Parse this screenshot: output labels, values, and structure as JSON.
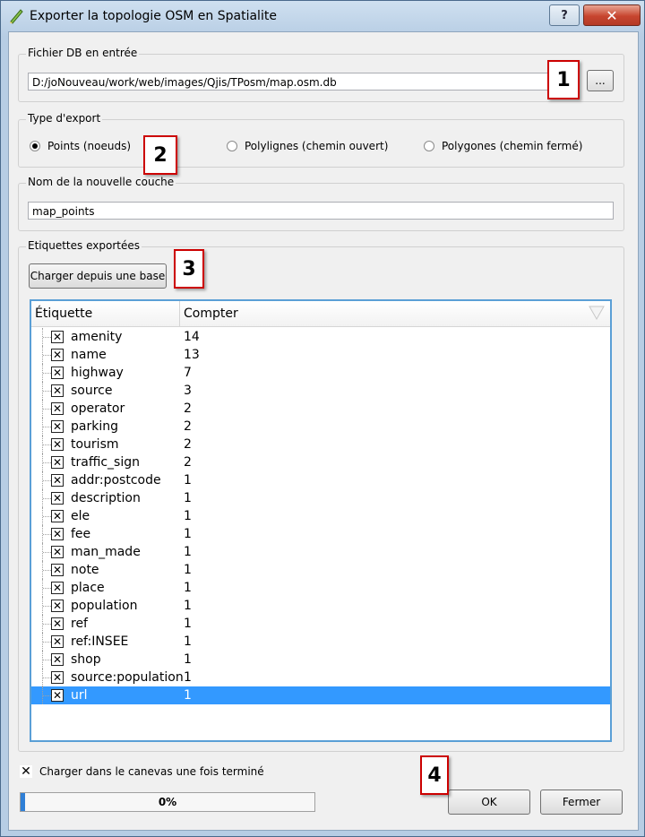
{
  "window": {
    "title": "Exporter la topologie OSM en Spatialite",
    "help_glyph": "?",
    "close_glyph": "✕"
  },
  "db_group": {
    "label": "Fichier DB en entrée",
    "path": "D:/joNouveau/work/web/images/Qjis/TPosm/map.osm.db",
    "browse_label": "..."
  },
  "export_group": {
    "label": "Type d'export",
    "options": [
      {
        "label": "Points (noeuds)",
        "selected": true
      },
      {
        "label": "Polylignes (chemin ouvert)",
        "selected": false
      },
      {
        "label": "Polygones (chemin fermé)",
        "selected": false
      }
    ]
  },
  "layer_group": {
    "label": "Nom de la nouvelle couche",
    "value": "map_points"
  },
  "tags_group": {
    "label": "Etiquettes exportées",
    "load_button": "Charger depuis une base",
    "columns": [
      "Étiquette",
      "Compter"
    ],
    "rows": [
      {
        "tag": "amenity",
        "count": "14",
        "checked": true
      },
      {
        "tag": "name",
        "count": "13",
        "checked": true
      },
      {
        "tag": "highway",
        "count": "7",
        "checked": true
      },
      {
        "tag": "source",
        "count": "3",
        "checked": true
      },
      {
        "tag": "operator",
        "count": "2",
        "checked": true
      },
      {
        "tag": "parking",
        "count": "2",
        "checked": true
      },
      {
        "tag": "tourism",
        "count": "2",
        "checked": true
      },
      {
        "tag": "traffic_sign",
        "count": "2",
        "checked": true
      },
      {
        "tag": "addr:postcode",
        "count": "1",
        "checked": true
      },
      {
        "tag": "description",
        "count": "1",
        "checked": true
      },
      {
        "tag": "ele",
        "count": "1",
        "checked": true
      },
      {
        "tag": "fee",
        "count": "1",
        "checked": true
      },
      {
        "tag": "man_made",
        "count": "1",
        "checked": true
      },
      {
        "tag": "note",
        "count": "1",
        "checked": true
      },
      {
        "tag": "place",
        "count": "1",
        "checked": true
      },
      {
        "tag": "population",
        "count": "1",
        "checked": true
      },
      {
        "tag": "ref",
        "count": "1",
        "checked": true
      },
      {
        "tag": "ref:INSEE",
        "count": "1",
        "checked": true
      },
      {
        "tag": "shop",
        "count": "1",
        "checked": true
      },
      {
        "tag": "source:population",
        "count": "1",
        "checked": true
      },
      {
        "tag": "url",
        "count": "1",
        "checked": true,
        "selected": true
      }
    ]
  },
  "load_in_canvas": {
    "label": "Charger dans le canevas une fois terminé",
    "checked": true
  },
  "progress": {
    "text": "0%",
    "value": 0.015
  },
  "buttons": {
    "ok": "OK",
    "close": "Fermer"
  },
  "callouts": [
    "1",
    "2",
    "3",
    "4"
  ],
  "check_glyph": "✕",
  "colors": {
    "selection": "#3399ff",
    "callout_border": "#cc0000",
    "progress": "#2f7fd6"
  }
}
